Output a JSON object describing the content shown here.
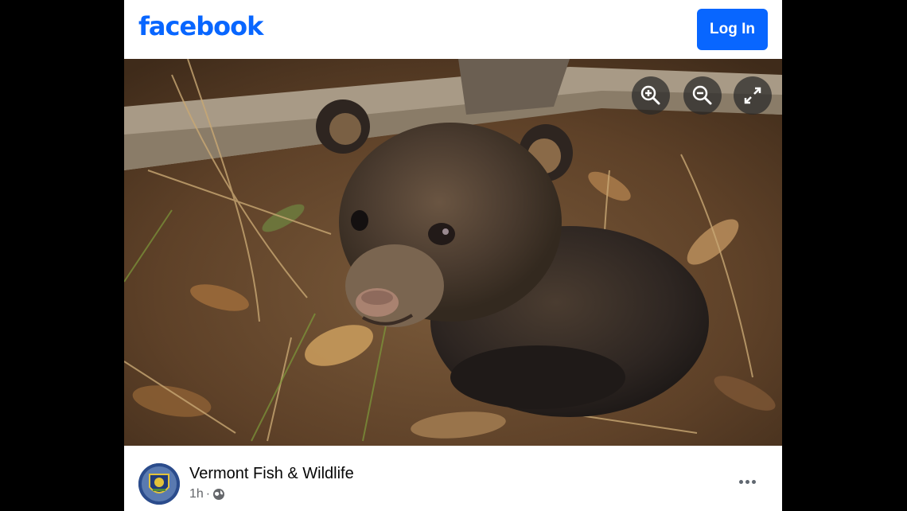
{
  "header": {
    "logo_text": "facebook",
    "login_label": "Log In",
    "brand_color": "#0866ff"
  },
  "photo": {
    "subject": "black bear cub in autumn leaves",
    "controls": [
      {
        "icon": "zoom-in-icon"
      },
      {
        "icon": "zoom-out-icon"
      },
      {
        "icon": "fullscreen-icon"
      }
    ]
  },
  "post": {
    "page_name": "Vermont Fish & Wildlife",
    "time": "1h",
    "separator": "·",
    "audience_icon": "globe-icon",
    "menu_icon": "more-options-icon"
  }
}
